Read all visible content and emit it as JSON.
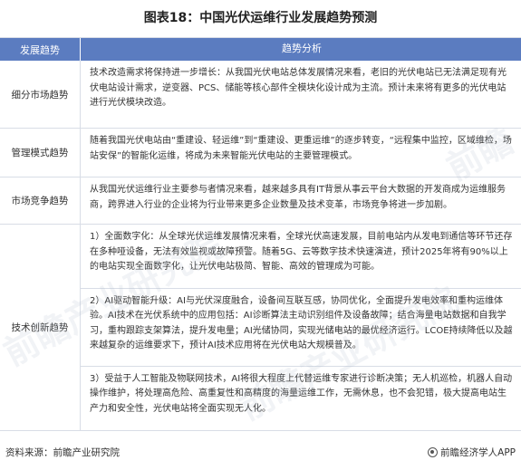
{
  "title": "图表18：中国光伏运维行业发展趋势预测",
  "table": {
    "header": {
      "left": "发展趋势",
      "right": "趋势分析"
    },
    "rows": [
      {
        "label": "细分市场趋势",
        "text": "技术改造需求将保持进一步增长：从我国光伏电站总体发展情况来看，老旧的光伏电站已无法满足现有光伏电站设计需求，逆变器、PCS、储能等核心部件全模块化设计成为主流。预计未来将有更多的光伏电站进行光伏模块改造。"
      },
      {
        "label": "管理模式趋势",
        "text": "随着我国光伏电站由“重建设、轻运维”到“重建设、更重运维”的逐步转变，“远程集中监控，区域维检，场站安保”的智能化运维，将成为未来智能光伏电站的主要管理模式。"
      },
      {
        "label": "市场竞争趋势",
        "text": "从我国光伏运维行业主要参与者情况来看，越来越多具有IT背景从事云平台大数据的开发商成为运维服务商，跨界进入行业的企业将为行业带来更多企业数量及技术变革，市场竞争将进一步加剧。"
      }
    ],
    "tech": {
      "label": "技术创新趋势",
      "items": [
        "1）全面数字化：从全球光伏运维发展情况来看，全球光伏高速发展，目前电站内从发电到通信等环节还存在多种哑设备，无法有效监视或故障预警。随着5G、云等数字技术快速演进，预计2025年将有90%以上的电站实现全面数字化，让光伏电站极简、智能、高效的管理成为可能。",
        "2）AI驱动智能升级：AI与光伏深度融合，设备间互联互感，协同优化，全面提升发电效率和重构运维体验。AI技术在光伏系统中的应用包括：AI诊断算法主动识别组件及设备故障；结合海量电站数据和自我学习，重构跟踪支架算法，提升发电量；AI光储协同，实现光储电站的最优经济运行。LCOE持续降低以及越来越复杂的运维要求下，预计AI技术应用将在光伏电站大规模普及。",
        "3）受益于人工智能及物联网技术，AI将很大程度上代替运维专家进行诊断决策；无人机巡检，机器人自动操作维护，将处理高危险、高重复性和高精度的海量运维工作，无需休息，也不会犯错，极大提高电站生产力和安全性，光伏电站将全面实现无人化。"
      ]
    }
  },
  "footer": {
    "source": "资料来源：前瞻产业研究院",
    "brand": "前瞻经济学人APP"
  },
  "watermark": [
    "前瞻产业研究院",
    "前瞻产业研究院",
    "前瞻"
  ],
  "colors": {
    "header_bg": "#5b7cc0",
    "border": "#d8dde6",
    "text": "#333333"
  }
}
